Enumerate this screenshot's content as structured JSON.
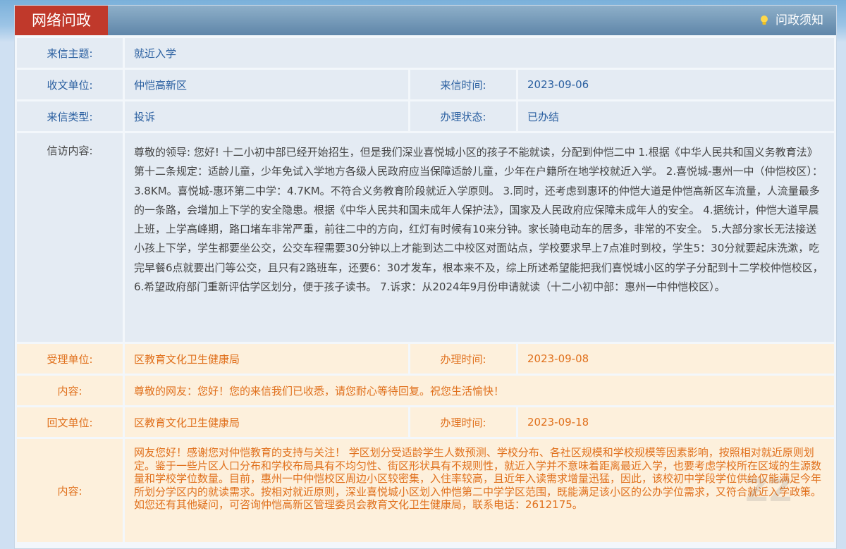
{
  "header": {
    "title": "网络问政",
    "notice_label": "问政须知"
  },
  "letter": {
    "subject_label": "来信主题:",
    "subject": "就近入学",
    "recipient_label": "收文单位:",
    "recipient": "仲恺高新区",
    "time_label": "来信时间:",
    "time": "2023-09-06",
    "type_label": "来信类型:",
    "type": "投诉",
    "status_label": "办理状态:",
    "status": "已办结",
    "content_label": "信访内容:",
    "content": "尊敬的领导: 您好! 十二小初中部已经开始招生，但是我们深业喜悦城小区的孩子不能就读，分配到仲恺二中 1.根据《中华人民共和国义务教育法》第十二条规定：适龄儿童，少年免试入学地方各级人民政府应当保障适龄儿童，少年在户籍所在地学校就近入学。 2.喜悦城-惠州一中（仲恺校区）：3.8KM。喜悦城-惠环第二中学：4.7KM。不符合义务教育阶段就近入学原则。 3.同时，还考虑到惠环的仲恺大道是仲恺高新区车流量，人流量最多的一条路，会增加上下学的安全隐患。根据《中华人民共和国未成年人保护法》，国家及人民政府应保障未成年人的安全。 4.据统计，仲恺大道早晨上班，上学高峰期，路口堵车非常严重，前往二中的方向，红灯有时候有10来分钟。家长骑电动车的居多，非常的不安全。 5.大部分家长无法接送小孩上下学，学生都要坐公交，公交车程需要30分钟以上才能到达二中校区对面站点，学校要求早上7点准时到校，学生5：30分就要起床洗漱，吃完早餐6点就要出门等公交，且只有2路班车，还要6：30才发车，根本来不及，综上所述希望能把我们喜悦城小区的学子分配到十二学校仲恺校区， 6.希望政府部门重新评估学区划分，便于孩子读书。 7.诉求：从2024年9月份申请就读（十二小初中部：惠州一中仲恺校区）。"
  },
  "accept": {
    "unit_label": "受理单位:",
    "unit": "区教育文化卫生健康局",
    "time_label": "办理时间:",
    "time": "2023-09-08",
    "content_label": "内容:",
    "content": "尊敬的网友：您好！您的来信我们已收悉，请您耐心等待回复。祝您生活愉快！"
  },
  "reply": {
    "unit_label": "回文单位:",
    "unit": "区教育文化卫生健康局",
    "time_label": "办理时间:",
    "time": "2023-09-18",
    "content_label": "内容:",
    "content": "网友您好！感谢您对仲恺教育的支持与关注！ 学区划分受适龄学生人数预测、学校分布、各社区规模和学校规模等因素影响，按照相对就近原则划定。鉴于一些片区人口分布和学校布局具有不均匀性、街区形状具有不规则性，就近入学并不意味着距离最近入学，也要考虑学校所在区域的生源数量和学校学位数量。目前，惠州一中仲恺校区周边小区较密集，入住率较高，且近年入读需求增量迅猛，因此，该校初中学段学位供给仅能满足今年所划分学区内的就读需求。按相对就近原则，深业喜悦城小区划入仲恺第二中学学区范围，既能满足该小区的公办学位需求，又符合就近入学政策。如您还有其他疑问，可咨询仲恺高新区管理委员会教育文化卫生健康局，联系电话：2612175。"
  },
  "colors": {
    "title_red": "#c0392b",
    "blue_text": "#2a5fa0",
    "orange_text": "#e0701c"
  }
}
